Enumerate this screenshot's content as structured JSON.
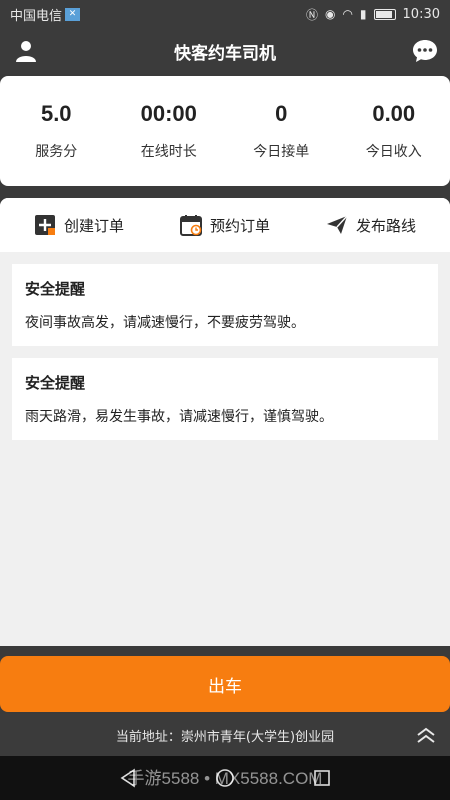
{
  "status_bar": {
    "carrier": "中国电信",
    "carrier_badge": "✕",
    "time": "10:30",
    "icons": [
      "nfc-icon",
      "eye-icon",
      "wifi-icon",
      "signal-icon",
      "battery-icon"
    ]
  },
  "header": {
    "title": "快客约车司机",
    "left_icon": "user-icon",
    "right_icon": "message-icon"
  },
  "stats": [
    {
      "value": "5.0",
      "label": "服务分"
    },
    {
      "value": "00:00",
      "label": "在线时长"
    },
    {
      "value": "0",
      "label": "今日接单"
    },
    {
      "value": "0.00",
      "label": "今日收入"
    }
  ],
  "actions": [
    {
      "label": "创建订单",
      "icon": "create-order-icon"
    },
    {
      "label": "预约订单",
      "icon": "calendar-icon"
    },
    {
      "label": "发布路线",
      "icon": "send-icon"
    }
  ],
  "notices": [
    {
      "title": "安全提醒",
      "text": "夜间事故高发，请减速慢行，不要疲劳驾驶。"
    },
    {
      "title": "安全提醒",
      "text": "雨天路滑，易发生事故，请减速慢行，谨慎驾驶。"
    }
  ],
  "go_button": {
    "label": "出车"
  },
  "address": {
    "text": "当前地址：崇州市青年(大学生)创业园"
  },
  "watermark": "手游5588 • MX5588.COM",
  "colors": {
    "accent": "#f77d10",
    "header": "#3b3b3b",
    "background": "#f0f0f0"
  }
}
